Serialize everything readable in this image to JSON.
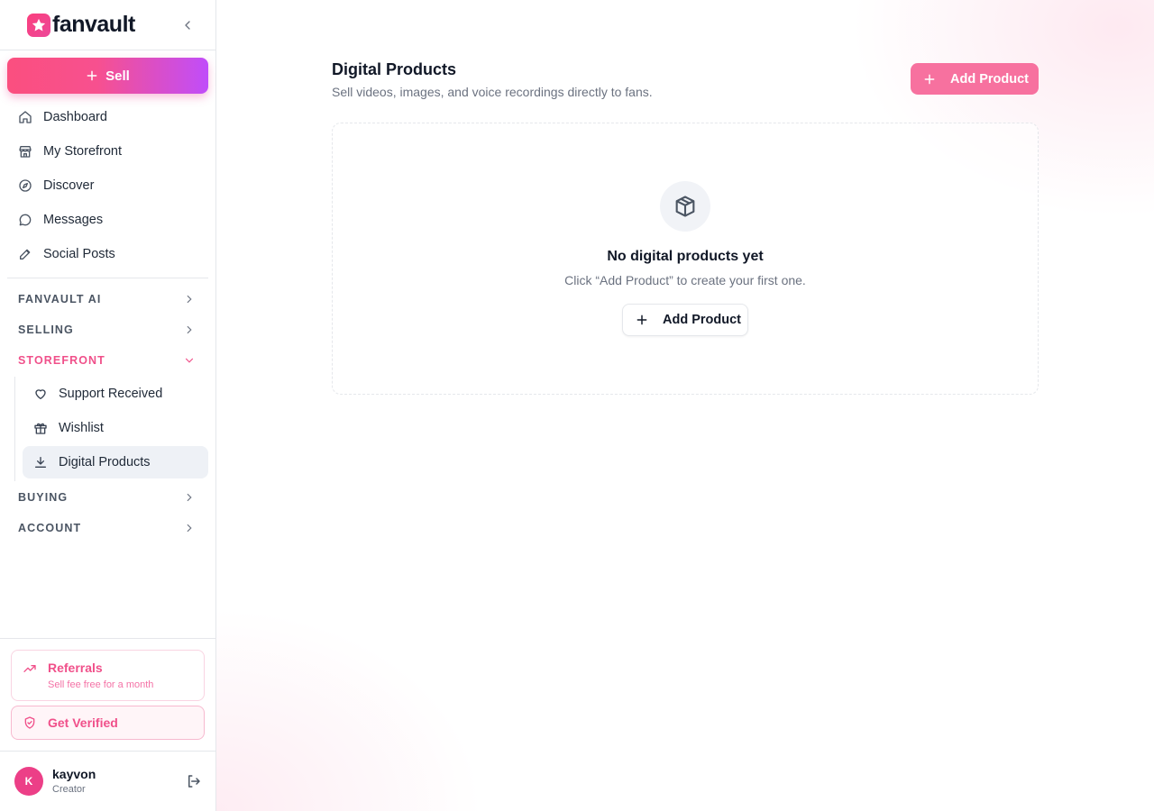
{
  "brand": {
    "name": "fanvault",
    "logo_icon": "star-icon",
    "accent": "#f0508a"
  },
  "sidebar": {
    "sell_label": "Sell",
    "main_items": [
      {
        "label": "Dashboard",
        "icon": "home-icon"
      },
      {
        "label": "My Storefront",
        "icon": "store-icon"
      },
      {
        "label": "Discover",
        "icon": "compass-icon"
      },
      {
        "label": "Messages",
        "icon": "message-icon"
      },
      {
        "label": "Social Posts",
        "icon": "pencil-icon"
      }
    ],
    "sections": [
      {
        "label": "FANVAULT AI",
        "expanded": false
      },
      {
        "label": "SELLING",
        "expanded": false
      },
      {
        "label": "STOREFRONT",
        "expanded": true
      },
      {
        "label": "BUYING",
        "expanded": false
      },
      {
        "label": "ACCOUNT",
        "expanded": false
      }
    ],
    "storefront_items": [
      {
        "label": "Support Received",
        "icon": "heart-icon"
      },
      {
        "label": "Wishlist",
        "icon": "gift-icon"
      },
      {
        "label": "Digital Products",
        "icon": "download-icon",
        "active": true
      }
    ],
    "referrals": {
      "title": "Referrals",
      "subtitle": "Sell fee free for a month"
    },
    "verified": {
      "label": "Get Verified"
    },
    "user": {
      "initial": "K",
      "name": "kayvon",
      "role": "Creator"
    }
  },
  "main": {
    "title": "Digital Products",
    "subtitle": "Sell videos, images, and voice recordings directly to fans.",
    "add_button": "Add Product",
    "empty": {
      "title": "No digital products yet",
      "subtitle": "Click “Add Product” to create your first one.",
      "button": "Add Product"
    }
  }
}
